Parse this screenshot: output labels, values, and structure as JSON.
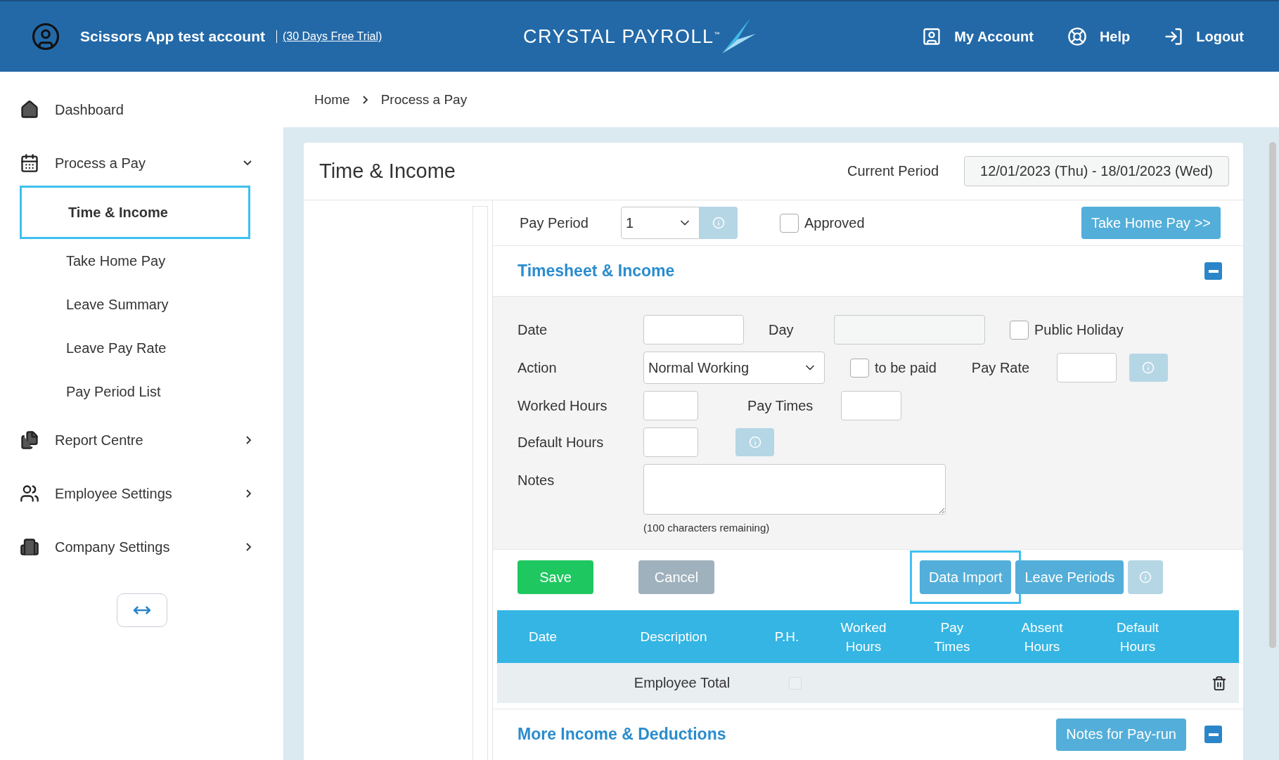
{
  "header": {
    "account_name": "Scissors App test account",
    "trial_link": "(30 Days Free Trial)",
    "logo_text": "CRYSTAL PAYROLL",
    "logo_mark": "™",
    "nav": [
      {
        "kind": "account",
        "label": "My Account"
      },
      {
        "kind": "help",
        "label": "Help"
      },
      {
        "kind": "logout",
        "label": "Logout"
      }
    ]
  },
  "sidebar": {
    "items": [
      {
        "kind": "home",
        "label": "Dashboard"
      },
      {
        "kind": "calendar",
        "label": "Process a Pay",
        "expanded": true,
        "children": [
          {
            "label": "Time & Income",
            "selected": true
          },
          {
            "label": "Take Home Pay",
            "selected": false
          },
          {
            "label": "Leave Summary",
            "selected": false
          },
          {
            "label": "Leave Pay Rate",
            "selected": false
          },
          {
            "label": "Pay Period List",
            "selected": false
          }
        ]
      },
      {
        "kind": "report",
        "label": "Report Centre",
        "expanded": false
      },
      {
        "kind": "people",
        "label": "Employee Settings",
        "expanded": false
      },
      {
        "kind": "building",
        "label": "Company Settings",
        "expanded": false
      }
    ]
  },
  "breadcrumb": [
    "Home",
    "Process a Pay"
  ],
  "card": {
    "title": "Time & Income",
    "current_period_label": "Current Period",
    "current_period": "12/01/2023 (Thu) - 18/01/2023 (Wed)"
  },
  "pay_period": {
    "label": "Pay Period",
    "value": "1",
    "approved": {
      "label": "Approved",
      "checked": false
    },
    "take_home_button": "Take Home Pay >>"
  },
  "timesheet": {
    "title": "Timesheet & Income",
    "expanded": true,
    "date_label": "Date",
    "day_label": "Day",
    "public_holiday": {
      "label": "Public Holiday",
      "checked": false
    },
    "action_label": "Action",
    "action_value": "Normal Working",
    "to_be_paid": {
      "label": "to be paid",
      "checked": false
    },
    "pay_rate_label": "Pay Rate",
    "worked_hours_label": "Worked Hours",
    "pay_times_label": "Pay Times",
    "default_hours_label": "Default Hours",
    "notes_label": "Notes",
    "notes_remaining": "(100 characters remaining)"
  },
  "actions": [
    {
      "kind": "save",
      "label": "Save",
      "focused": false
    },
    {
      "kind": "cancel",
      "label": "Cancel",
      "focused": false
    },
    {
      "kind": "primary",
      "label": "Data Import",
      "focused": true
    },
    {
      "kind": "primary",
      "label": "Leave Periods",
      "focused": false
    }
  ],
  "table": {
    "columns": [
      "Date",
      "Description",
      "P.H.",
      "Worked Hours",
      "Pay Times",
      "Absent Hours",
      "Default Hours"
    ],
    "rows": [
      {
        "description": "Employee Total",
        "ph_checked": false
      }
    ]
  },
  "more": {
    "title": "More Income & Deductions",
    "notes_button": "Notes for Pay-run",
    "expanded": true
  }
}
